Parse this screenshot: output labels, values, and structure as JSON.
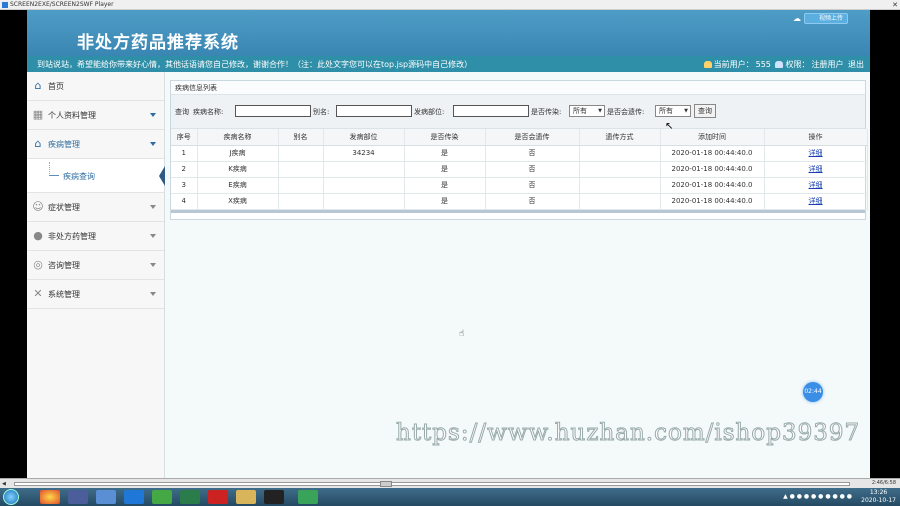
{
  "window": {
    "title": "SCREEN2EXE/SCREEN2SWF Player"
  },
  "header": {
    "site_title": "非处方药品推荐系统",
    "upload_label": "视频上传"
  },
  "notice": {
    "message": "到站说站，希望能给你带来好心情，其他话语请您自己修改，谢谢合作！（注：此处文字您可以在top.jsp源码中自己修改）",
    "user_label": "当前用户：",
    "user_value": "555",
    "role_label": "权限：",
    "role_value": "注册用户",
    "logout_label": "退出"
  },
  "sidebar": {
    "home": "首页",
    "items": [
      {
        "label": "个人资料管理",
        "icon": "grid-icon"
      },
      {
        "label": "疾病管理",
        "icon": "home-icon"
      },
      {
        "label": "症状管理",
        "icon": "users-icon"
      },
      {
        "label": "非处方药管理",
        "icon": "user-icon"
      },
      {
        "label": "咨询管理",
        "icon": "chat-icon"
      },
      {
        "label": "系统管理",
        "icon": "tools-icon"
      }
    ],
    "sub_item": "疾病查询"
  },
  "panel": {
    "title": "疾病信息列表",
    "search": {
      "prefix": "查询",
      "name_label": "疾病名称:",
      "alias_label": "别名:",
      "site_label": "发病部位:",
      "infectious_label": "是否传染:",
      "infectious_value": "所有",
      "hereditary_label": "是否会遗传:",
      "hereditary_value": "所有",
      "query_button": "查询"
    },
    "columns": [
      "序号",
      "疾病名称",
      "别名",
      "发病部位",
      "是否传染",
      "是否会遗传",
      "遗传方式",
      "添加时间",
      "操作"
    ],
    "rows": [
      [
        "1",
        "J疾病",
        "",
        "34234",
        "是",
        "否",
        "",
        "2020-01-18 00:44:40.0",
        "详细"
      ],
      [
        "2",
        "K疾病",
        "",
        "",
        "是",
        "否",
        "",
        "2020-01-18 00:44:40.0",
        "详细"
      ],
      [
        "3",
        "E疾病",
        "",
        "",
        "是",
        "否",
        "",
        "2020-01-18 00:44:40.0",
        "详细"
      ],
      [
        "4",
        "X疾病",
        "",
        "",
        "是",
        "否",
        "",
        "2020-01-18 00:44:40.0",
        "详细"
      ]
    ]
  },
  "bubble_time": "02:44",
  "watermark": "https://www.huzhan.com/ishop39397",
  "player": {
    "time": "2:46/6:58"
  },
  "taskbar": {
    "time": "13:26",
    "date": "2020-10-17"
  }
}
